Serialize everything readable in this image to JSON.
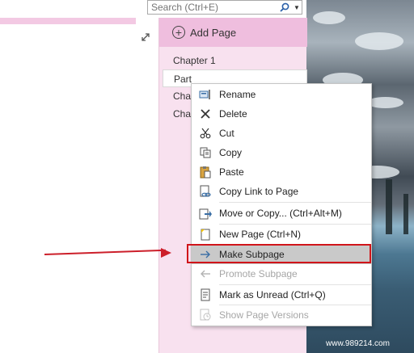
{
  "search": {
    "placeholder": "Search (Ctrl+E)"
  },
  "page_pane": {
    "add_page_label": "Add Page",
    "pages": [
      {
        "label": "Chapter 1",
        "selected": false
      },
      {
        "label": "Part",
        "selected": true
      },
      {
        "label": "Chap",
        "selected": false
      },
      {
        "label": "Chap",
        "selected": false
      }
    ]
  },
  "context_menu": {
    "items": [
      {
        "label": "Rename",
        "icon": "rename-icon",
        "disabled": false
      },
      {
        "label": "Delete",
        "icon": "delete-icon",
        "disabled": false
      },
      {
        "label": "Cut",
        "icon": "scissors-icon",
        "disabled": false
      },
      {
        "label": "Copy",
        "icon": "copy-icon",
        "disabled": false
      },
      {
        "label": "Paste",
        "icon": "paste-icon",
        "disabled": false
      },
      {
        "label": "Copy Link to Page",
        "icon": "link-icon",
        "disabled": false
      },
      {
        "label": "Move or Copy...  (Ctrl+Alt+M)",
        "icon": "move-copy-icon",
        "disabled": false
      },
      {
        "label": "New Page  (Ctrl+N)",
        "icon": "new-page-icon",
        "disabled": false
      },
      {
        "label": "Make Subpage",
        "icon": "arrow-right-icon",
        "disabled": false,
        "highlighted": true
      },
      {
        "label": "Promote Subpage",
        "icon": "arrow-left-icon",
        "disabled": true
      },
      {
        "label": "Mark as Unread  (Ctrl+Q)",
        "icon": "mark-unread-icon",
        "disabled": false
      },
      {
        "label": "Show Page Versions",
        "icon": "page-versions-icon",
        "disabled": true
      }
    ]
  },
  "watermark": "www.989214.com",
  "colors": {
    "pane_pink": "#f8e1ef",
    "add_page_pink": "#efbede",
    "annotation_red": "#d0151a",
    "highlight_gray": "#c9c9c9"
  }
}
